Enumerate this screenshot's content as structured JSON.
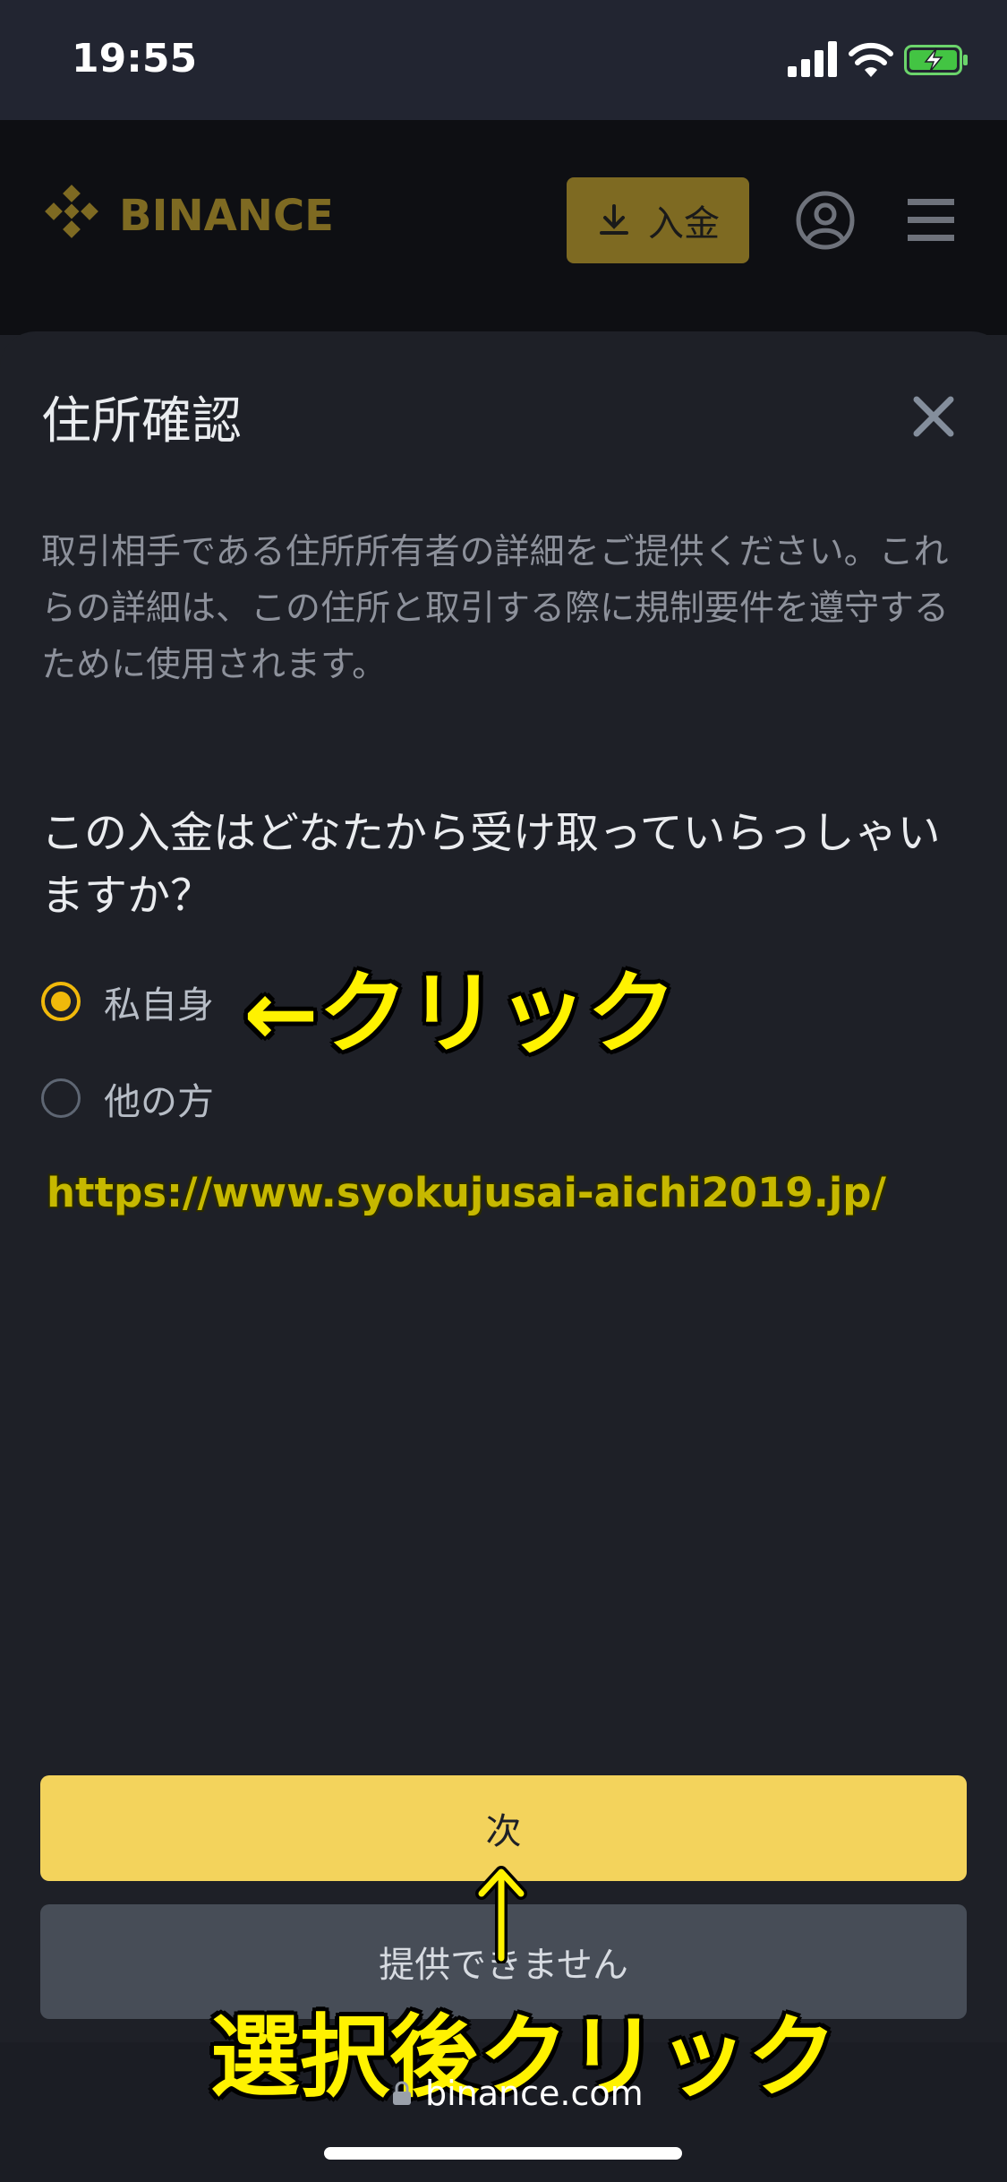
{
  "status_bar": {
    "time": "19:55"
  },
  "header": {
    "logo_text": "BINANCE",
    "deposit_label": "入金"
  },
  "sheet": {
    "title": "住所確認",
    "description": "取引相手である住所所有者の詳細をご提供ください。これらの詳細は、この住所と取引する際に規制要件を遵守するために使用されます。",
    "question": "この入金はどなたから受け取っていらっしゃいますか？",
    "options": [
      {
        "label": "私自身",
        "selected": true
      },
      {
        "label": "他の方",
        "selected": false
      }
    ],
    "next_label": "次",
    "cannot_label": "提供できません"
  },
  "annotations": {
    "click": "←クリック",
    "after_select": "選択後クリック",
    "watermark_url": "https://www.syokujusai-aichi2019.jp/"
  },
  "browser": {
    "domain": "binance.com"
  },
  "colors": {
    "accent": "#f0b90b",
    "next_button": "#f3d35c",
    "annotation": "#fff200"
  }
}
